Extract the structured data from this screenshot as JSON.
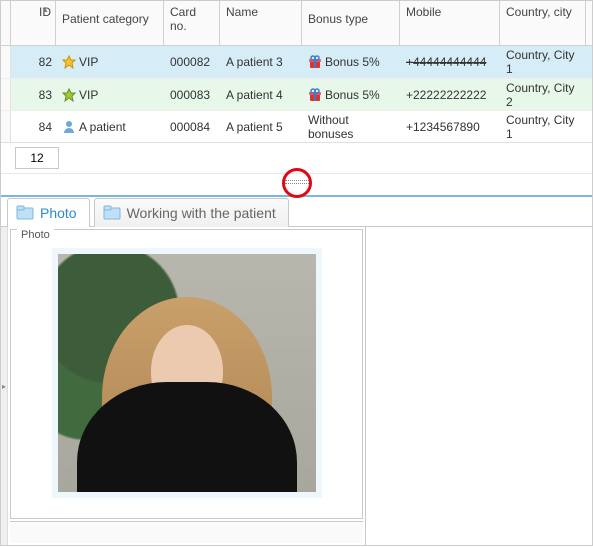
{
  "columns": {
    "id": "ID",
    "category": "Patient category",
    "card": "Card no.",
    "name": "Name",
    "bonus": "Bonus type",
    "mobile": "Mobile",
    "country": "Country, city"
  },
  "rows": [
    {
      "id": "82",
      "cat_icon": "star-gold",
      "category": "VIP",
      "card": "000082",
      "name": "A patient 3",
      "bonus_icon": "gift",
      "bonus": "Bonus 5%",
      "mobile": "+44444444444",
      "mobile_strike": true,
      "country": "Country, City 1",
      "style": "selected"
    },
    {
      "id": "83",
      "cat_icon": "star-green",
      "category": "VIP",
      "card": "000083",
      "name": "A patient 4",
      "bonus_icon": "gift",
      "bonus": "Bonus 5%",
      "mobile": "+22222222222",
      "mobile_strike": false,
      "country": "Country, City 2",
      "style": "alt"
    },
    {
      "id": "84",
      "cat_icon": "person",
      "category": "A patient",
      "card": "000084",
      "name": "A patient 5",
      "bonus_icon": "",
      "bonus": "Without bonuses",
      "mobile": "+1234567890",
      "mobile_strike": false,
      "country": "Country, City 1",
      "style": "normal"
    }
  ],
  "pager": {
    "value": "12"
  },
  "tabs": {
    "photo": "Photo",
    "working": "Working with the patient",
    "active": "photo"
  },
  "photo_panel": {
    "legend": "Photo"
  }
}
